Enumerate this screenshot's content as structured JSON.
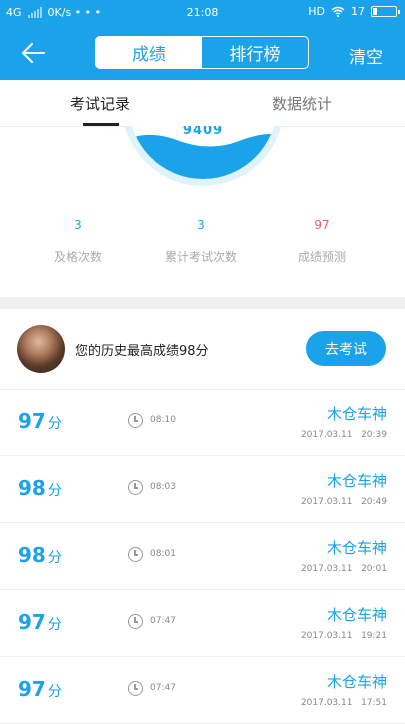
{
  "status_bar": {
    "network": "4G",
    "speed": "0K/s • • •",
    "time": "21:08",
    "hd": "HD",
    "battery": "17",
    "battery_level": 0.17
  },
  "header": {
    "segments": [
      "成绩",
      "排行榜"
    ],
    "active_segment": 0,
    "clear_label": "清空"
  },
  "tabs": [
    {
      "label": "考试记录",
      "active": true
    },
    {
      "label": "数据统计",
      "active": false
    }
  ],
  "gauge": {
    "score_text": "9409"
  },
  "stats": [
    {
      "value": "3",
      "label": "及格次数",
      "color": "#1aa3e8"
    },
    {
      "value": "3",
      "label": "累计考试次数",
      "color": "#1aa3e8"
    },
    {
      "value": "97",
      "label": "成绩预测",
      "color": "#e9645c"
    }
  ],
  "profile": {
    "best_text": "您的历史最高成绩98分",
    "go_exam_label": "去考试"
  },
  "records": [
    {
      "score": "97",
      "unit": "分",
      "duration": "08:10",
      "user": "木仓车神",
      "date": "2017.03.11",
      "time": "20:39"
    },
    {
      "score": "98",
      "unit": "分",
      "duration": "08:03",
      "user": "木仓车神",
      "date": "2017.03.11",
      "time": "20:49"
    },
    {
      "score": "98",
      "unit": "分",
      "duration": "08:01",
      "user": "木仓车神",
      "date": "2017.03.11",
      "time": "20:01"
    },
    {
      "score": "97",
      "unit": "分",
      "duration": "07:47",
      "user": "木仓车神",
      "date": "2017.03.11",
      "time": "19:21"
    },
    {
      "score": "97",
      "unit": "分",
      "duration": "07:47",
      "user": "木仓车神",
      "date": "2017.03.11",
      "time": "17:51"
    }
  ],
  "colors": {
    "accent": "#1aa3e8",
    "prediction": "#e9645c"
  }
}
